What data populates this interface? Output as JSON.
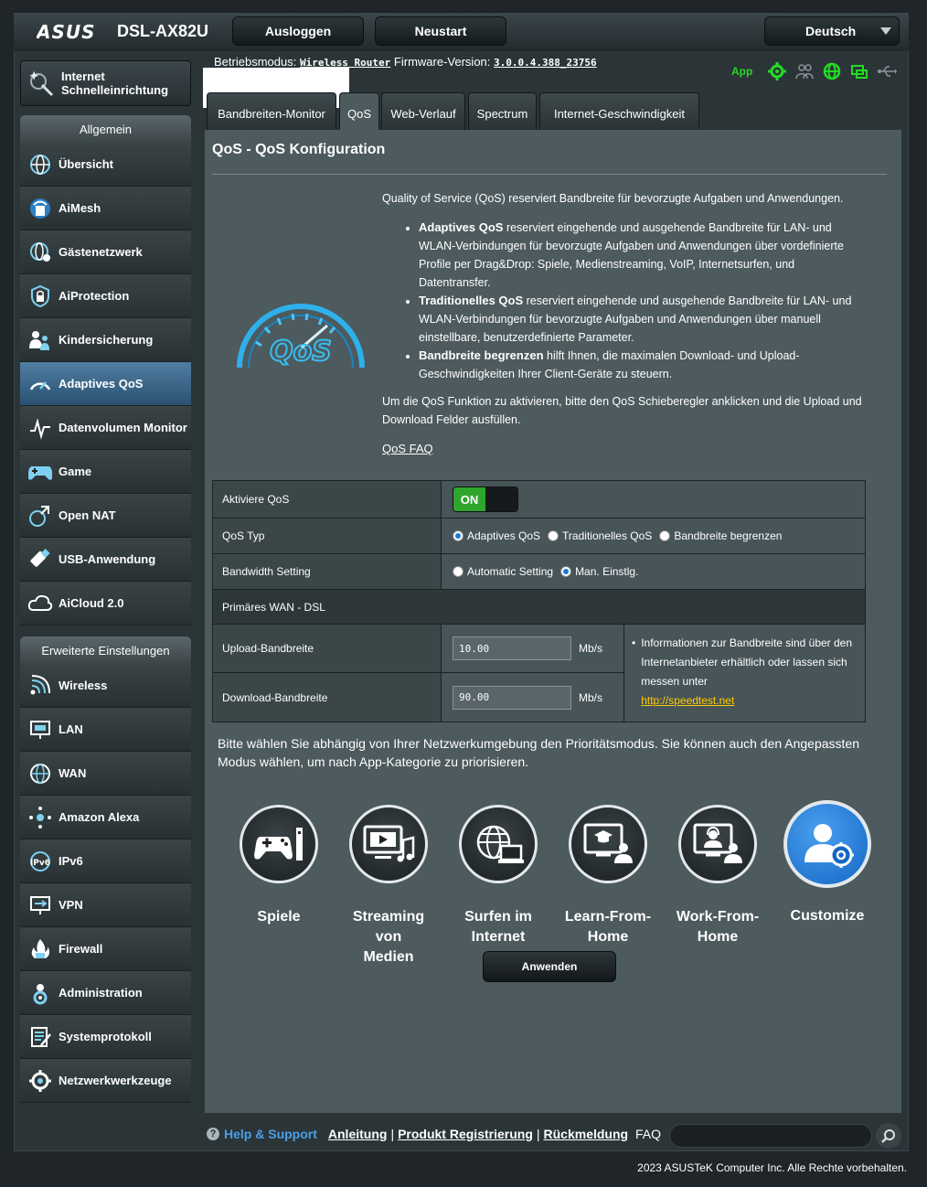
{
  "brand": {
    "logo": "/ISUS",
    "model": "DSL-AX82U"
  },
  "topbar": {
    "logout": "Ausloggen",
    "restart": "Neustart",
    "language": "Deutsch"
  },
  "status": {
    "mode_label": "Betriebsmodus:",
    "mode_value": "Wireless Router",
    "fw_label": "Firmware-Version:",
    "fw_value": "3.0.0.4.388_23756",
    "app_label": "App"
  },
  "quick_setup": {
    "label_line1": "Internet",
    "label_line2": "Schnelleinrichtung"
  },
  "sidebar": {
    "general_title": "Allgemein",
    "general_items": [
      {
        "label": "Übersicht",
        "icon": "globe-icon"
      },
      {
        "label": "AiMesh",
        "icon": "mesh-icon"
      },
      {
        "label": "Gästenetzwerk",
        "icon": "guest-network-icon"
      },
      {
        "label": "AiProtection",
        "icon": "shield-lock-icon"
      },
      {
        "label": "Kindersicherung",
        "icon": "family-icon"
      },
      {
        "label": "Adaptives QoS",
        "icon": "speedometer-icon",
        "active": true
      },
      {
        "label": "Datenvolumen Monitor",
        "icon": "traffic-monitor-icon"
      },
      {
        "label": "Game",
        "icon": "gamepad-icon"
      },
      {
        "label": "Open NAT",
        "icon": "open-nat-icon"
      },
      {
        "label": "USB-Anwendung",
        "icon": "usb-icon"
      },
      {
        "label": "AiCloud 2.0",
        "icon": "cloud-icon"
      }
    ],
    "advanced_title": "Erweiterte Einstellungen",
    "advanced_items": [
      {
        "label": "Wireless",
        "icon": "wireless-icon"
      },
      {
        "label": "LAN",
        "icon": "lan-icon"
      },
      {
        "label": "WAN",
        "icon": "wan-globe-icon"
      },
      {
        "label": "Amazon Alexa",
        "icon": "alexa-icon"
      },
      {
        "label": "IPv6",
        "icon": "ipv6-icon"
      },
      {
        "label": "VPN",
        "icon": "vpn-icon"
      },
      {
        "label": "Firewall",
        "icon": "firewall-icon"
      },
      {
        "label": "Administration",
        "icon": "admin-gear-icon"
      },
      {
        "label": "Systemprotokoll",
        "icon": "system-log-icon"
      },
      {
        "label": "Netzwerkwerkzeuge",
        "icon": "network-tools-icon"
      }
    ]
  },
  "tabs": [
    {
      "label": "Bandbreiten-Monitor"
    },
    {
      "label": "QoS",
      "active": true
    },
    {
      "label": "Web-Verlauf"
    },
    {
      "label": "Spectrum"
    },
    {
      "label": "Internet-Geschwindigkeit"
    }
  ],
  "page": {
    "title": "QoS - QoS Konfiguration",
    "intro": "Quality of Service (QoS) reserviert Bandbreite für bevorzugte Aufgaben und Anwendungen.",
    "bullets": [
      {
        "bold": "Adaptives QoS",
        "text": " reserviert eingehende und ausgehende Bandbreite für LAN- und WLAN-Verbindungen für bevorzugte Aufgaben und Anwendungen über vordefinierte Profile per Drag&Drop: Spiele, Medienstreaming, VoIP, Internetsurfen, und Datentransfer."
      },
      {
        "bold": "Traditionelles QoS",
        "text": " reserviert eingehende und ausgehende Bandbreite für LAN- und WLAN-Verbindungen für bevorzugte Aufgaben und Anwendungen über manuell einstellbare, benutzerdefinierte Parameter."
      },
      {
        "bold": "Bandbreite begrenzen",
        "text": " hilft Ihnen, die maximalen Download- und Upload-Geschwindigkeiten Ihrer Client-Geräte zu steuern."
      }
    ],
    "activate_hint": "Um die QoS Funktion zu aktivieren, bitte den QoS Schieberegler anklicken und die Upload und Download Felder ausfüllen.",
    "faq_link": "QoS FAQ",
    "logo_text": "QoS"
  },
  "settings": {
    "enable_label": "Aktiviere QoS",
    "enable_value": "ON",
    "type_label": "QoS Typ",
    "type_options": [
      "Adaptives QoS",
      "Traditionelles QoS",
      "Bandbreite begrenzen"
    ],
    "type_selected": 0,
    "bw_setting_label": "Bandwidth Setting",
    "bw_options": [
      "Automatic Setting",
      "Man. Einstlg."
    ],
    "bw_selected": 1,
    "wan_header": "Primäres WAN - DSL",
    "upload_label": "Upload-Bandbreite",
    "upload_value": "10.00",
    "download_label": "Download-Bandbreite",
    "download_value": "90.00",
    "unit": "Mb/s",
    "info_text": "Informationen zur Bandbreite sind über den Internetanbieter erhältlich oder lassen sich messen unter",
    "info_link": "http://speedtest.net"
  },
  "modes": {
    "intro": "Bitte wählen Sie abhängig von Ihrer Netzwerkumgebung den Prioritätsmodus. Sie können auch den Angepassten Modus wählen, um nach App-Kategorie zu priorisieren.",
    "items": [
      {
        "line1": "Spiele",
        "line2": "",
        "icon": "gamepad-icon"
      },
      {
        "line1": "Streaming von",
        "line2": "Medien",
        "icon": "streaming-icon"
      },
      {
        "line1": "Surfen im",
        "line2": "Internet",
        "icon": "surfing-icon"
      },
      {
        "line1": "Learn-From-",
        "line2": "Home",
        "icon": "learn-icon"
      },
      {
        "line1": "Work-From-",
        "line2": "Home",
        "icon": "work-icon"
      },
      {
        "line1": "Customize",
        "line2": "",
        "icon": "customize-icon",
        "selected": true
      }
    ],
    "apply": "Anwenden"
  },
  "footer": {
    "help": "Help & Support",
    "links": [
      "Anleitung",
      "Produkt Registrierung",
      "Rückmeldung"
    ],
    "faq": "FAQ",
    "copyright": "2023 ASUSTeK Computer Inc. Alle Rechte vorbehalten."
  },
  "colors": {
    "accent": "#2a5172",
    "on": "#2ea62e",
    "link": "#ffcc00",
    "help": "#4a9fe8"
  }
}
